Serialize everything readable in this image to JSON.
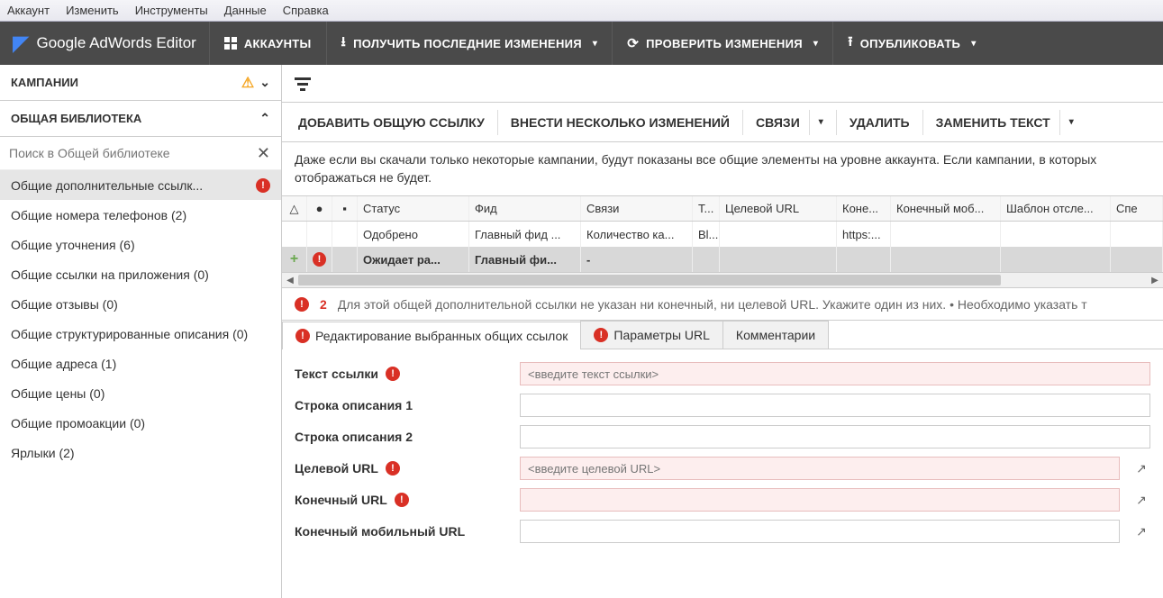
{
  "menubar": [
    "Аккаунт",
    "Изменить",
    "Инструменты",
    "Данные",
    "Справка"
  ],
  "logo": {
    "brand": "Google",
    "product": "AdWords Editor"
  },
  "toolbar": {
    "accounts": "АККАУНТЫ",
    "get_changes": "ПОЛУЧИТЬ ПОСЛЕДНИЕ ИЗМЕНЕНИЯ",
    "check_changes": "ПРОВЕРИТЬ ИЗМЕНЕНИЯ",
    "publish": "ОПУБЛИКОВАТЬ"
  },
  "sidebar": {
    "campaigns_header": "КАМПАНИИ",
    "library_header": "ОБЩАЯ БИБЛИОТЕКА",
    "search_placeholder": "Поиск в Общей библиотеке",
    "items": [
      {
        "label": "Общие дополнительные ссылк...",
        "active": true,
        "error": true
      },
      {
        "label": "Общие номера телефонов (2)"
      },
      {
        "label": "Общие уточнения (6)"
      },
      {
        "label": "Общие ссылки на приложения (0)"
      },
      {
        "label": "Общие отзывы (0)"
      },
      {
        "label": "Общие структурированные описания (0)"
      },
      {
        "label": "Общие адреса (1)"
      },
      {
        "label": "Общие цены (0)"
      },
      {
        "label": "Общие промоакции (0)"
      },
      {
        "label": "Ярлыки (2)"
      }
    ]
  },
  "actions": {
    "add": "ДОБАВИТЬ ОБЩУЮ ССЫЛКУ",
    "bulk": "ВНЕСТИ НЕСКОЛЬКО ИЗМЕНЕНИЙ",
    "links": "СВЯЗИ",
    "delete": "УДАЛИТЬ",
    "replace": "ЗАМЕНИТЬ ТЕКСТ"
  },
  "note": "Даже если вы скачали только некоторые кампании, будут показаны все общие элементы на уровне аккаунта. Если кампании, в которых отображаться не будет.",
  "table": {
    "headers": [
      "",
      "",
      "",
      "Статус",
      "Фид",
      "Связи",
      "Т...",
      "Целевой URL",
      "Коне...",
      "Конечный моб...",
      "Шаблон отсле...",
      "Спе"
    ],
    "rows": [
      {
        "c0": "",
        "c1": "",
        "c2": "",
        "status": "Одобрено",
        "feed": "Главный фид ...",
        "links": "Количество ка...",
        "t": "Bl...",
        "dest": "",
        "final": "https:...",
        "mob": "",
        "tmpl": "",
        "spe": ""
      },
      {
        "c0": "+",
        "c1": "!",
        "c2": "",
        "status": "Ожидает ра...",
        "feed": "Главный фи...",
        "links": "-",
        "t": "",
        "dest": "",
        "final": "",
        "mob": "",
        "tmpl": "",
        "spe": "",
        "selected": true
      }
    ]
  },
  "error_strip": {
    "count": "2",
    "msg": "Для этой общей дополнительной ссылки не указан ни конечный, ни целевой URL. Укажите один из них. • Необходимо указать т"
  },
  "tabs": [
    {
      "label": "Редактирование выбранных общих ссылок",
      "error": true,
      "active": true
    },
    {
      "label": "Параметры URL",
      "error": true
    },
    {
      "label": "Комментарии"
    }
  ],
  "form": {
    "link_text": {
      "label": "Текст ссылки",
      "placeholder": "<введите текст ссылки>",
      "error": true
    },
    "desc1": {
      "label": "Строка описания 1"
    },
    "desc2": {
      "label": "Строка описания 2"
    },
    "dest_url": {
      "label": "Целевой URL",
      "placeholder": "<введите целевой URL>",
      "error": true,
      "ext": true
    },
    "final_url": {
      "label": "Конечный URL",
      "error": true,
      "ext": true,
      "err_bg": true
    },
    "mobile_url": {
      "label": "Конечный мобильный URL",
      "ext": true
    }
  }
}
